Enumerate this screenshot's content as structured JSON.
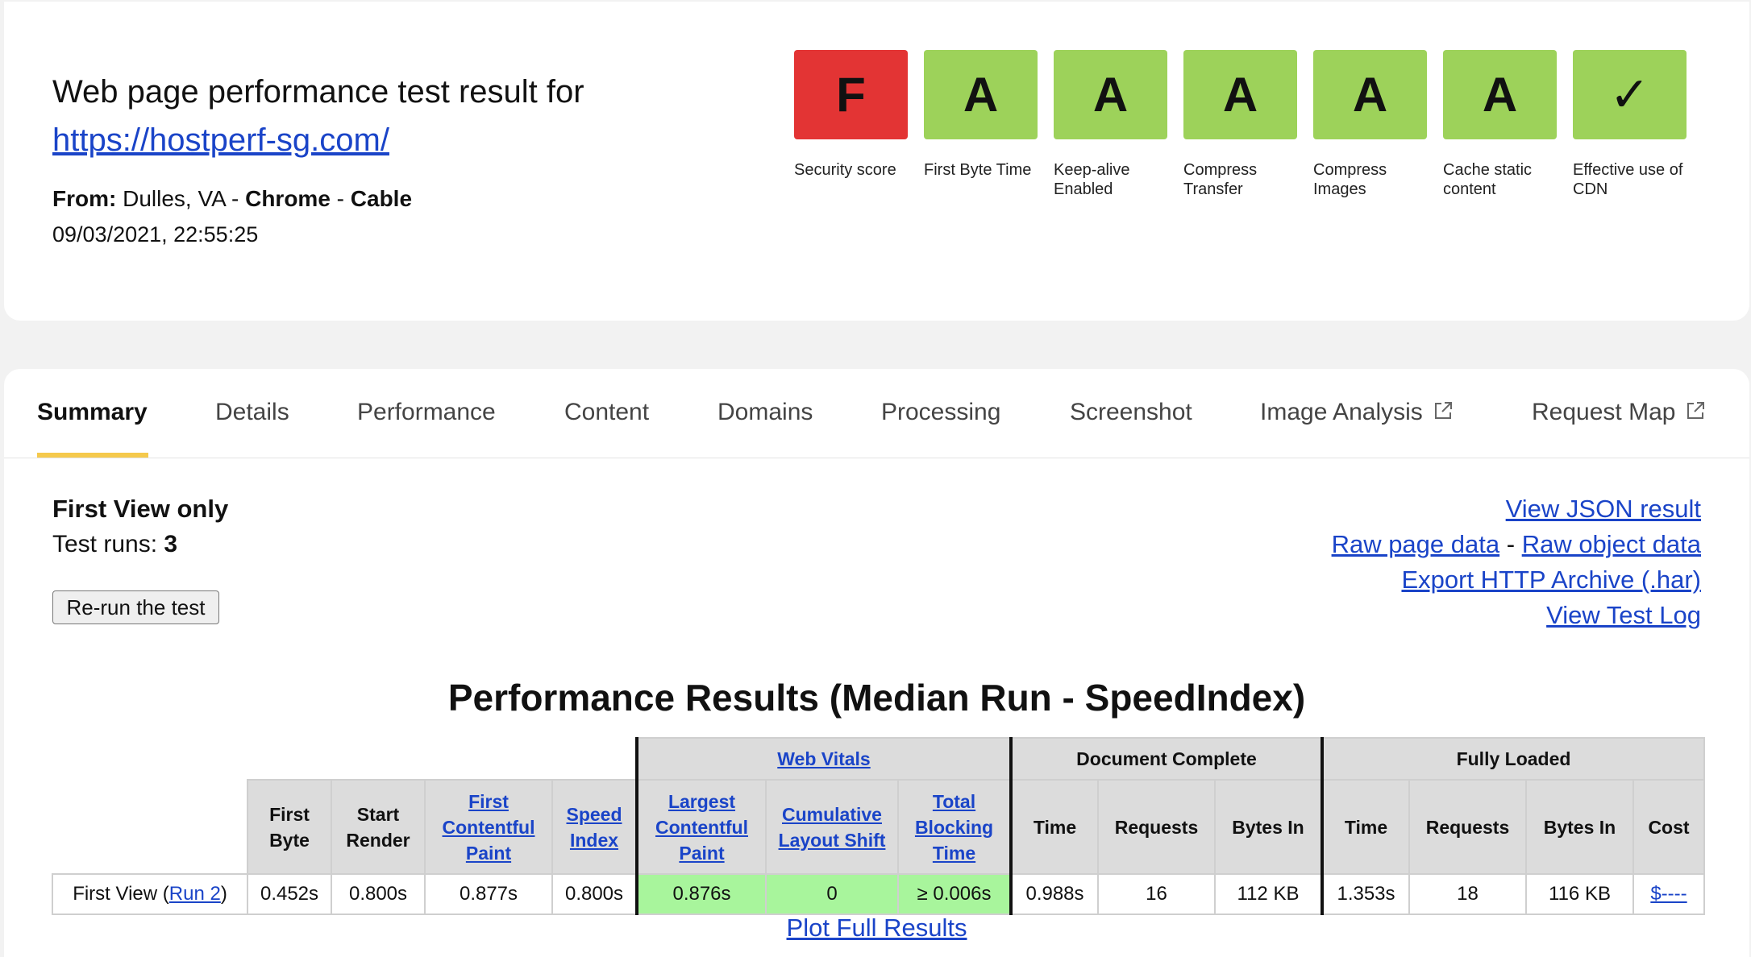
{
  "header": {
    "title": "Web page performance test result for",
    "url": "https://hostperf-sg.com/",
    "from_label": "From:",
    "location": "Dulles, VA",
    "separator": "-",
    "browser": "Chrome",
    "connection": "Cable",
    "timestamp": "09/03/2021, 22:55:25"
  },
  "grades": [
    {
      "grade": "F",
      "label": "Security score",
      "color": "#e33434"
    },
    {
      "grade": "A",
      "label": "First Byte Time",
      "color": "#9dd25a"
    },
    {
      "grade": "A",
      "label": "Keep-alive Enabled",
      "color": "#9dd25a"
    },
    {
      "grade": "A",
      "label": "Compress Transfer",
      "color": "#9dd25a"
    },
    {
      "grade": "A",
      "label": "Compress Images",
      "color": "#9dd25a"
    },
    {
      "grade": "A",
      "label": "Cache static content",
      "color": "#9dd25a"
    },
    {
      "grade": "✓",
      "label": "Effective use of CDN",
      "color": "#9dd25a"
    }
  ],
  "tabs": [
    "Summary",
    "Details",
    "Performance",
    "Content",
    "Domains",
    "Processing",
    "Screenshot",
    "Image Analysis",
    "Request Map"
  ],
  "summary": {
    "view_mode": "First View only",
    "test_runs_label": "Test runs:",
    "test_runs": "3",
    "rerun_label": "Re-run the test"
  },
  "links": {
    "json": "View JSON result",
    "raw_page": "Raw page data",
    "dash": "-",
    "raw_object": "Raw object data",
    "har": "Export HTTP Archive (.har)",
    "log": "View Test Log"
  },
  "results": {
    "title": "Performance Results (Median Run - SpeedIndex)",
    "groups": {
      "web_vitals": "Web Vitals",
      "document_complete": "Document Complete",
      "fully_loaded": "Fully Loaded"
    },
    "columns": {
      "first_byte": "First Byte",
      "start_render": "Start Render",
      "fcp": "First Contentful Paint",
      "speed_index": "Speed Index",
      "lcp": "Largest Contentful Paint",
      "cls": "Cumulative Layout Shift",
      "tbt": "Total Blocking Time",
      "time": "Time",
      "requests": "Requests",
      "bytes_in": "Bytes In",
      "cost": "Cost"
    },
    "row": {
      "label": "First View (",
      "run_link": "Run 2",
      "label_end": ")",
      "first_byte": "0.452s",
      "start_render": "0.800s",
      "fcp": "0.877s",
      "speed_index": "0.800s",
      "lcp": "0.876s",
      "cls": "0",
      "tbt": "≥ 0.006s",
      "doc_time": "0.988s",
      "doc_requests": "16",
      "doc_bytes": "112 KB",
      "full_time": "1.353s",
      "full_requests": "18",
      "full_bytes": "116 KB",
      "cost": "$----"
    },
    "plot_link": "Plot Full Results"
  }
}
